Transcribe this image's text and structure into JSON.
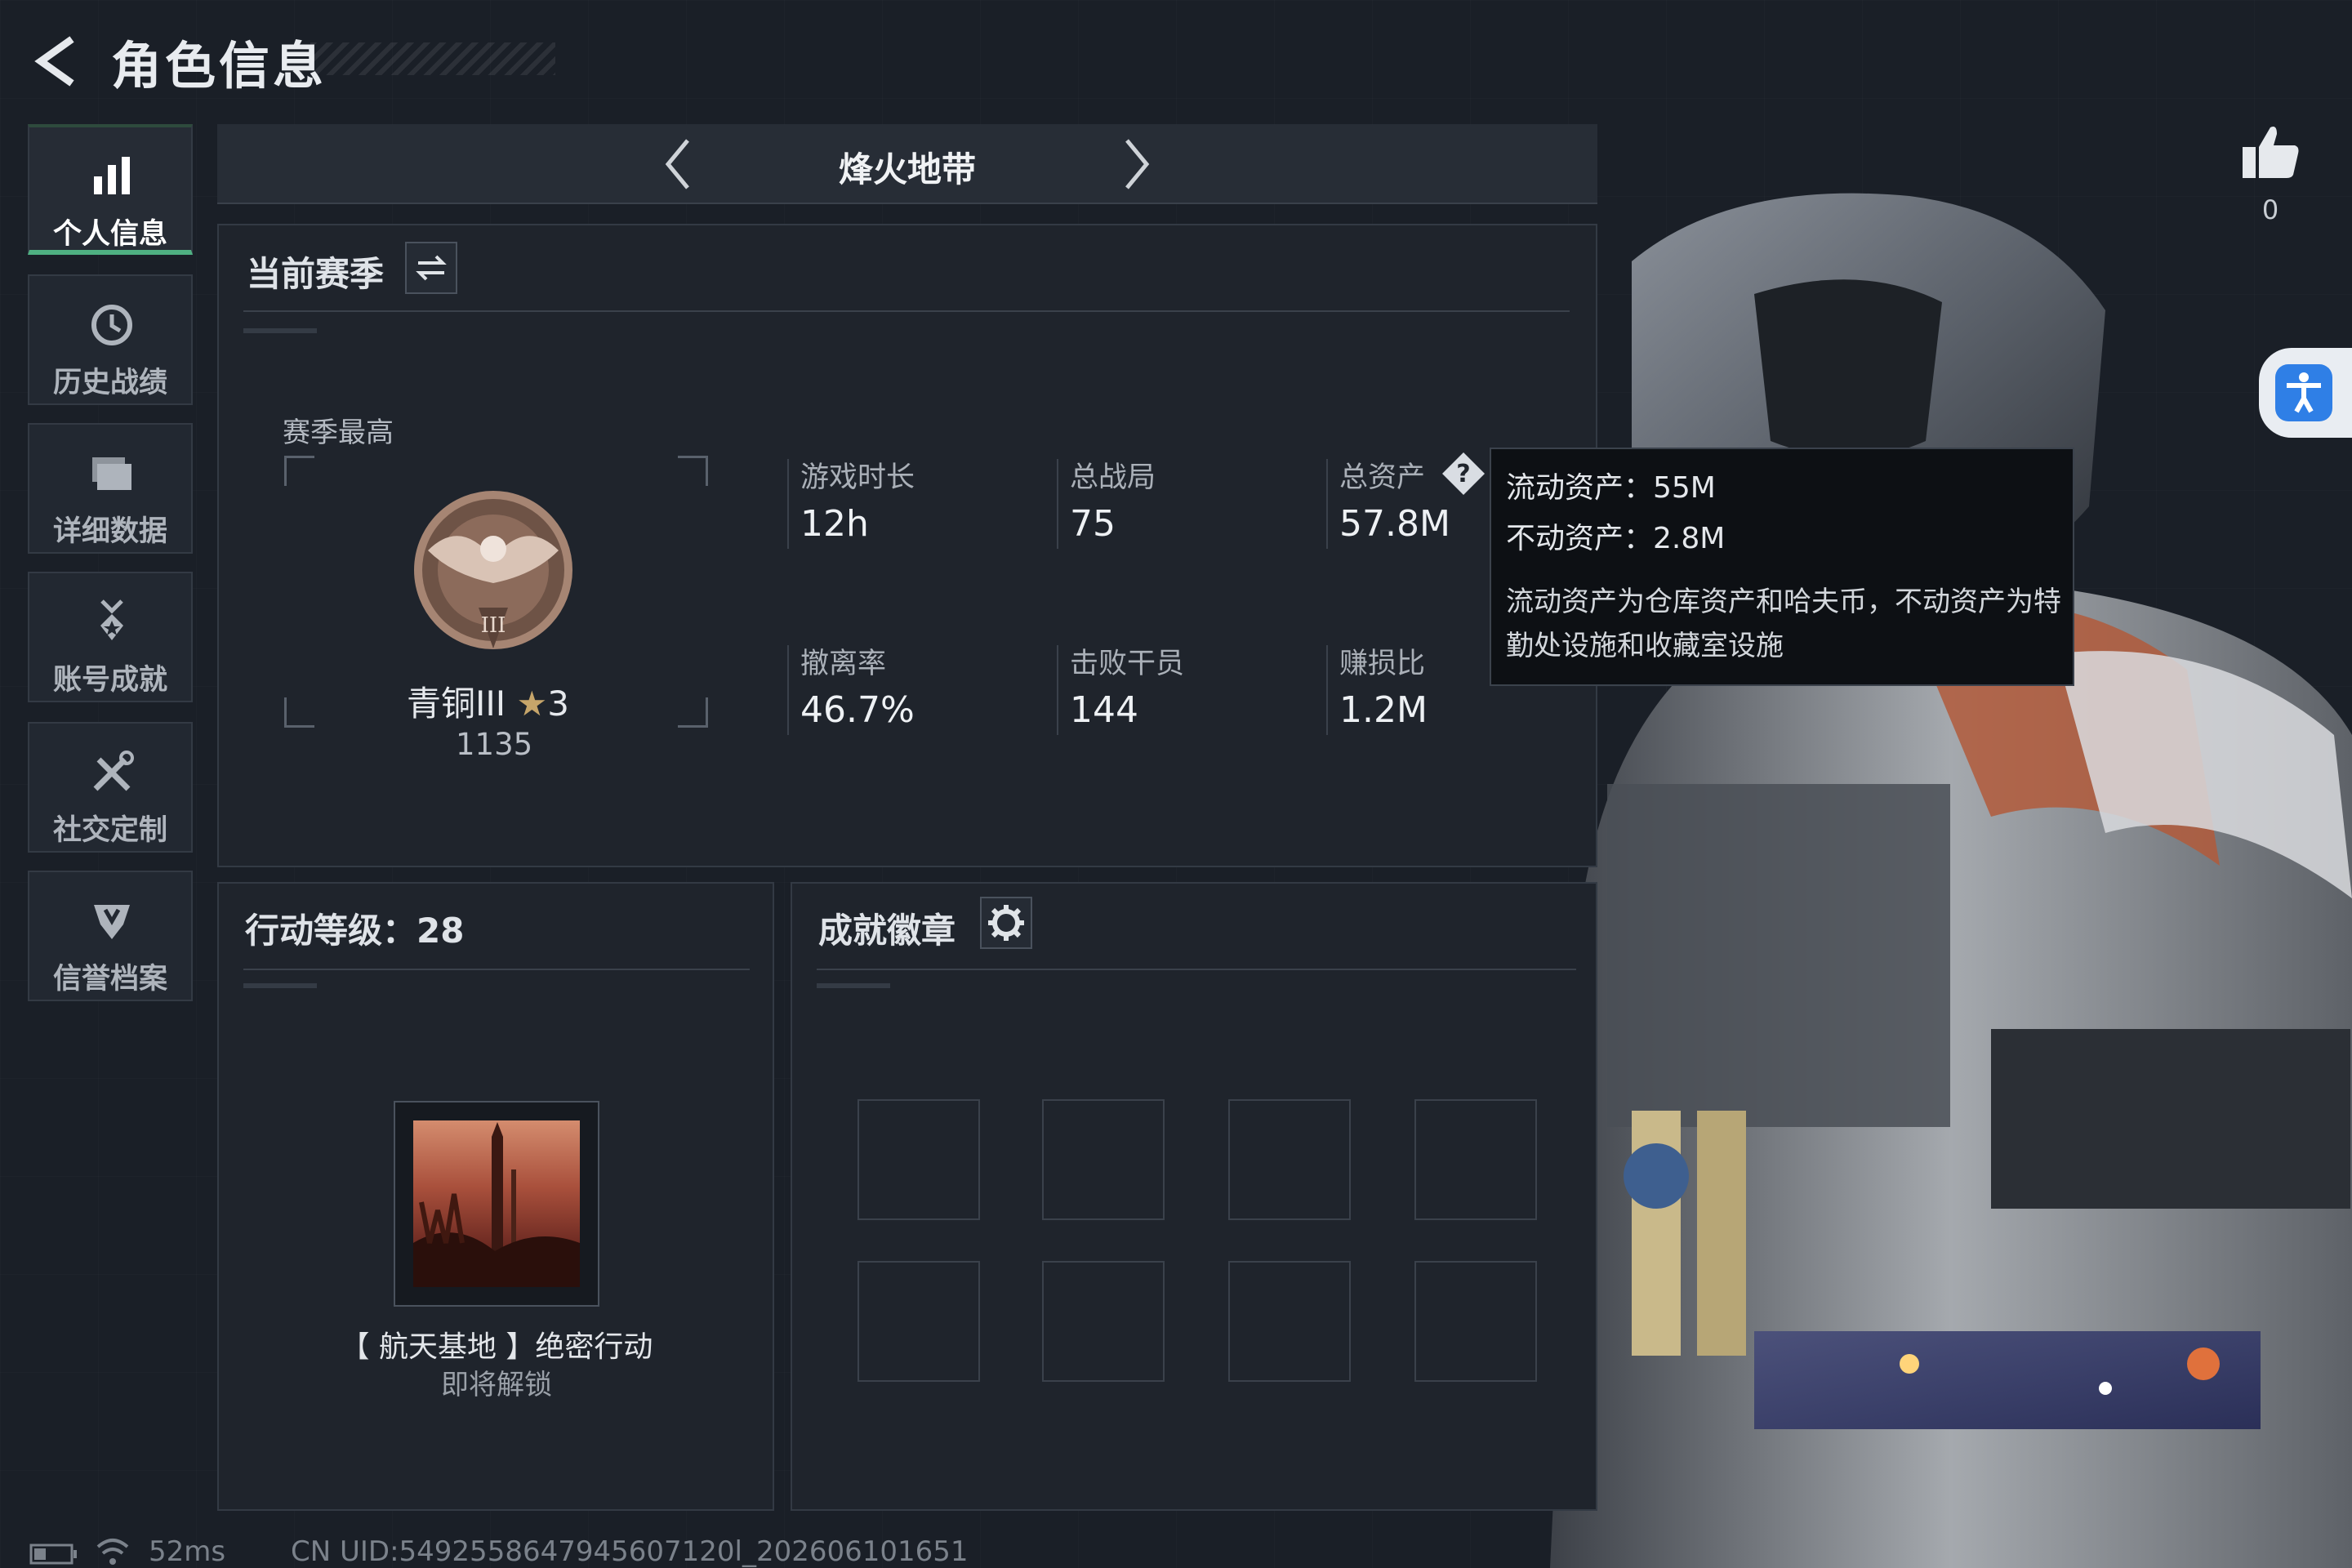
{
  "header": {
    "title": "角色信息"
  },
  "sidebar": {
    "items": [
      {
        "label": "个人信息",
        "icon": "bar-chart-icon",
        "active": true
      },
      {
        "label": "历史战绩",
        "icon": "clock-history-icon"
      },
      {
        "label": "详细数据",
        "icon": "folder-stack-icon"
      },
      {
        "label": "账号成就",
        "icon": "medal-icon"
      },
      {
        "label": "社交定制",
        "icon": "tools-icon"
      },
      {
        "label": "信誉档案",
        "icon": "shield-icon"
      }
    ]
  },
  "topbar": {
    "mode_title": "烽火地带"
  },
  "season": {
    "title": "当前赛季",
    "best_label": "赛季最高",
    "rank_name": "青铜III",
    "rank_stars": "3",
    "rank_score": "1135",
    "stats": [
      {
        "label": "游戏时长",
        "value": "12h"
      },
      {
        "label": "总战局",
        "value": "75"
      },
      {
        "label": "总资产",
        "value": "57.8M"
      },
      {
        "label": "撤离率",
        "value": "46.7%"
      },
      {
        "label": "击败干员",
        "value": "144"
      },
      {
        "label": "赚损比",
        "value": "1.2M"
      }
    ]
  },
  "tooltip": {
    "liquid": "流动资产：55M",
    "fixed": "不动资产：2.8M",
    "description": "流动资产为仓库资产和哈夫币，不动资产为特勤处设施和收藏室设施"
  },
  "action_level": {
    "title": "行动等级：28",
    "operation_name": "【 航天基地 】绝密行动",
    "operation_status": "即将解锁"
  },
  "badges": {
    "title": "成就徽章",
    "slots": 8
  },
  "likes": {
    "count": "0"
  },
  "status_bar": {
    "ping": "52ms",
    "uid": "CN UID:5492558647945607120l_202606101651"
  },
  "colors": {
    "accent": "#4fb082",
    "background": "#1a1f27",
    "panel": "#1f242c"
  }
}
